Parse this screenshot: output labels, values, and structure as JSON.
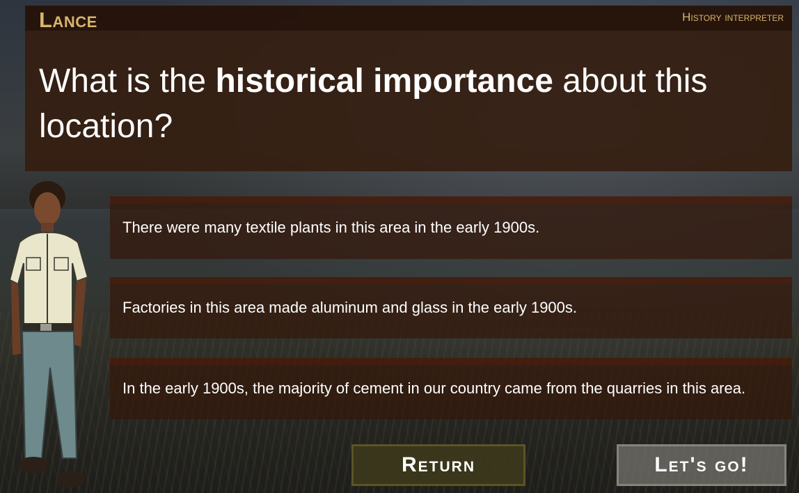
{
  "dialogue": {
    "speaker": "Lance",
    "role": "History interpreter",
    "question_prefix": "What is the ",
    "question_emphasis": "historical importance",
    "question_suffix": " about this location?"
  },
  "answers": [
    "There were many textile plants in this area in the early 1900s.",
    "Factories in this area made aluminum and glass in the early 1900s.",
    "In the early 1900s, the majority of cement in our country came from the quarries in this area."
  ],
  "buttons": {
    "return_label": "Return",
    "go_label": "Let's go!"
  },
  "colors": {
    "accent_gold": "#d8b56a",
    "panel_brown": "#34180a"
  },
  "icons": {
    "character": "history-interpreter-portrait"
  }
}
